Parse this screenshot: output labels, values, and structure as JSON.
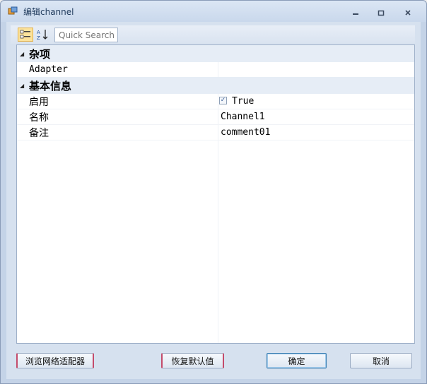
{
  "window": {
    "title": "编辑channel"
  },
  "toolbar": {
    "categorized_icon": "categorized-view-icon",
    "alphabetical_icon": "sort-alphabetical-icon",
    "search_placeholder": "Quick Search"
  },
  "grid": {
    "categories": [
      {
        "label": "杂项",
        "properties": [
          {
            "name": "Adapter",
            "value": ""
          }
        ]
      },
      {
        "label": "基本信息",
        "properties": [
          {
            "name": "启用",
            "value": "True",
            "checked": true
          },
          {
            "name": "名称",
            "value": "Channel1"
          },
          {
            "name": "备注",
            "value": "comment01"
          }
        ]
      }
    ]
  },
  "buttons": {
    "browse_adapter": "浏览网络适配器",
    "restore_default": "恢复默认值",
    "ok": "确定",
    "cancel": "取消"
  }
}
